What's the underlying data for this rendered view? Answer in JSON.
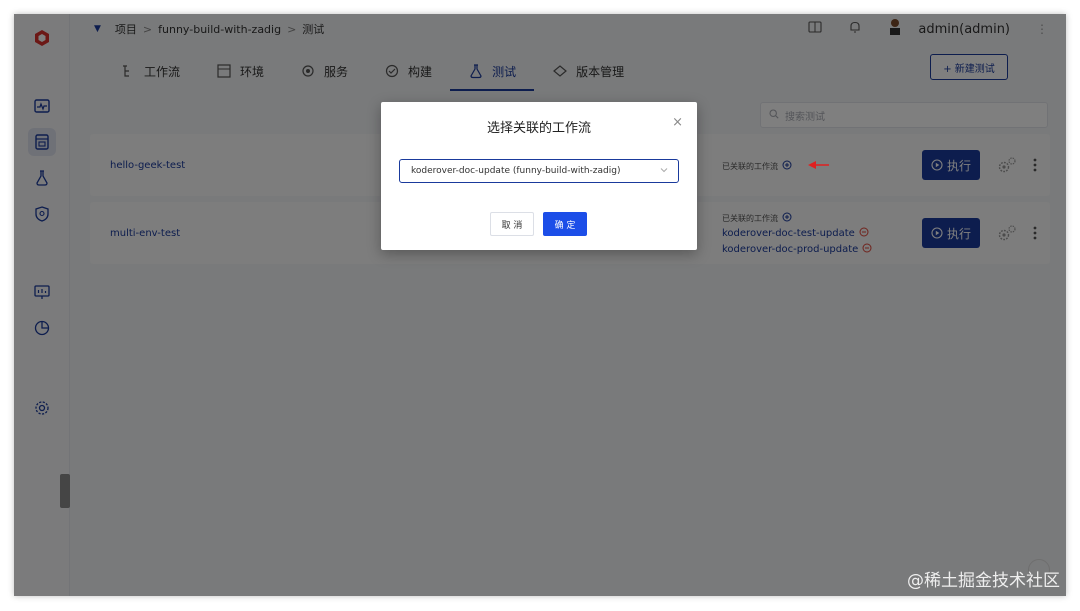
{
  "breadcrumb": {
    "items": [
      "项目",
      "funny-build-with-zadig",
      "测试"
    ],
    "separator": ">"
  },
  "user": {
    "name": "admin(admin)"
  },
  "tabs": [
    {
      "label": "工作流",
      "icon": "workflow-icon"
    },
    {
      "label": "环境",
      "icon": "environment-icon"
    },
    {
      "label": "服务",
      "icon": "service-icon"
    },
    {
      "label": "构建",
      "icon": "build-icon"
    },
    {
      "label": "测试",
      "icon": "flask-icon",
      "active": true
    },
    {
      "label": "版本管理",
      "icon": "version-icon"
    }
  ],
  "toolbar": {
    "new_test_label": "+ 新建测试"
  },
  "search": {
    "placeholder": "搜索测试"
  },
  "tests": [
    {
      "name": "hello-geek-test",
      "workflow_label": "已关联的工作流",
      "workflows": [],
      "run_label": "执行"
    },
    {
      "name": "multi-env-test",
      "workflow_label": "已关联的工作流",
      "workflows": [
        "koderover-doc-test-update",
        "koderover-doc-prod-update"
      ],
      "run_label": "执行"
    }
  ],
  "modal": {
    "title": "选择关联的工作流",
    "selected": "koderover-doc-update (funny-build-with-zadig)",
    "cancel_label": "取 消",
    "ok_label": "确 定",
    "close": "×"
  },
  "colors": {
    "primary": "#1a3a9c",
    "confirm": "#1c4ee8",
    "remove": "#e0463a",
    "arrow": "#e02020"
  },
  "watermark": "@稀土掘金技术社区"
}
